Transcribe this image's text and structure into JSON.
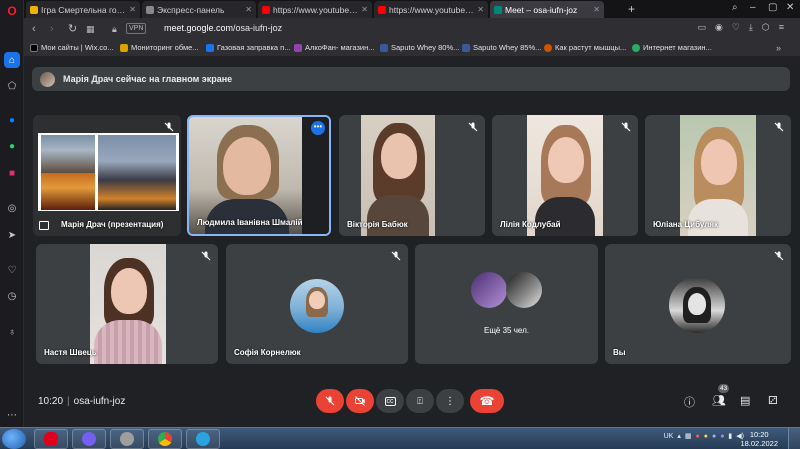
{
  "browser": {
    "tabs": [
      {
        "label": "Ігра Смертельна гонка он",
        "favicon_color": "#f0b400"
      },
      {
        "label": "Экспресс-панель",
        "favicon_color": "#888888"
      },
      {
        "label": "https://www.youtube.com/",
        "favicon_color": "#ff0000"
      },
      {
        "label": "https://www.youtube.com/",
        "favicon_color": "#ff0000"
      },
      {
        "label": "Meet – osa-iufn-joz",
        "favicon_color": "#00897b"
      }
    ],
    "new_tab": "+",
    "address": {
      "vpn": "VPN",
      "url_host": "meet.google.com",
      "url_path": "/osa-iufn-joz"
    },
    "bookmarks": [
      {
        "label": "Мои сайты | Wix.co...",
        "color": "#000000"
      },
      {
        "label": "Мониторинг обме...",
        "color": "#d9a300"
      },
      {
        "label": "Газовая заправка п...",
        "color": "#1a73e8"
      },
      {
        "label": "АлкоФан- магазин...",
        "color": "#8e44ad"
      },
      {
        "label": "Saputo Whey 80%...",
        "color": "#3b5998"
      },
      {
        "label": "Saputo Whey 85%...",
        "color": "#3b5998"
      },
      {
        "label": "Как растут мышцы...",
        "color": "#d35400"
      },
      {
        "label": "Интернет магазин...",
        "color": "#27ae60"
      }
    ]
  },
  "meet": {
    "banner": "Марія Драч сейчас на главном экране",
    "tiles": [
      {
        "name": "Марія Драч (презентация)",
        "muted": true
      },
      {
        "name": "Людмила Іванівна Шмалій",
        "muted": false
      },
      {
        "name": "Вікторія Бабюк",
        "muted": true
      },
      {
        "name": "Лілія Кодлубай",
        "muted": true
      },
      {
        "name": "Юліана Цибуляк",
        "muted": true
      },
      {
        "name": "Настя Швець",
        "muted": true
      },
      {
        "name": "Софія Корнелюк",
        "muted": true
      },
      {
        "name": "Ещё 35 чел.",
        "muted": false
      },
      {
        "name": "Вы",
        "muted": true
      }
    ],
    "time": "10:20",
    "meeting_code": "osa-iufn-joz",
    "participants_count": "43"
  },
  "taskbar": {
    "lang": "UK",
    "time": "10:20",
    "date": "18.02.2022"
  }
}
